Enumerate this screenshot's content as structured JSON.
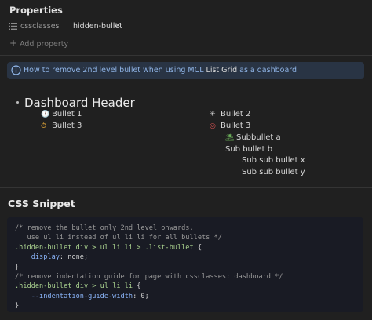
{
  "properties": {
    "title": "Properties",
    "items": [
      {
        "icon": "list-icon",
        "key": "cssclasses",
        "value": "hidden-bullet",
        "remove": "×"
      }
    ],
    "add_label": "Add property"
  },
  "callout": {
    "icon": "info-icon",
    "link_text": "How to remove 2nd level bullet when using MCL ",
    "plain_text": "List Grid",
    "link_text_2": " as a dashboard"
  },
  "dashboard": {
    "header": "Dashboard Header",
    "col1": [
      {
        "icon": "clock-emoji",
        "label": "Bullet 1"
      },
      {
        "icon": "stopwatch-emoji",
        "label": "Bullet 3"
      }
    ],
    "col2": [
      {
        "icon": "sparkle-emoji",
        "label": "Bullet 2"
      },
      {
        "icon": "target-emoji",
        "label": "Bullet 3"
      },
      {
        "icon": "palm-tree-emoji",
        "label": "Subbullet a"
      },
      {
        "icon": "",
        "label": "Sub bullet b"
      },
      {
        "icon": "",
        "label": "Sub sub bullet x"
      },
      {
        "icon": "",
        "label": "Sub sub bullet y"
      }
    ]
  },
  "css_section": {
    "title": "CSS Snippet",
    "code": {
      "l1": "/* remove the bullet only 2nd level onwards.",
      "l2": "   use ul li instead of ul li li for all bullets */",
      "l3_sel": ".hidden-bullet div > ul li li > .list-bullet",
      "l3_brace": " {",
      "l4_prop": "display",
      "l4_val": ": none;",
      "l5": "}",
      "l6": "/* remove indentation guide for page with cssclasses: dashboard */",
      "l7_sel": ".hidden-bullet div > ul li li",
      "l7_brace": " {",
      "l8_prop": "--indentation-guide-width",
      "l8_val": ": 0;",
      "l9": "}"
    }
  }
}
